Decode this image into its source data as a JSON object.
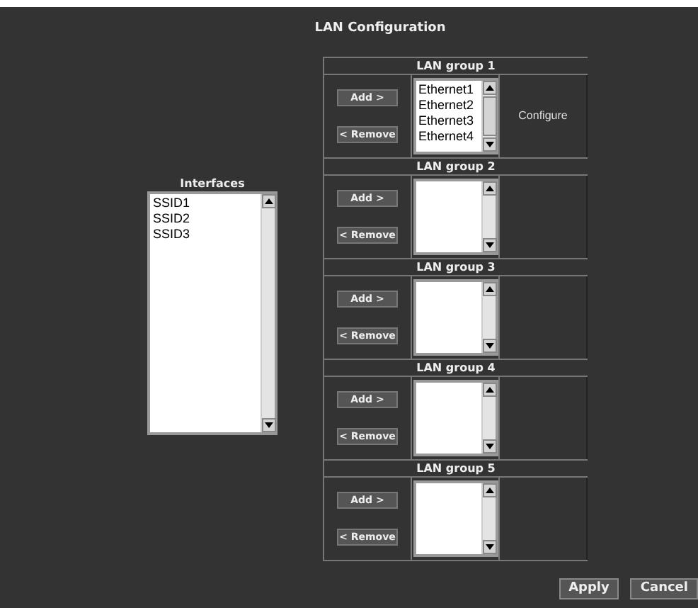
{
  "title": "LAN Configuration",
  "interfaces": {
    "label": "Interfaces",
    "items": [
      "SSID1",
      "SSID2",
      "SSID3"
    ]
  },
  "groups": [
    {
      "name": "LAN group 1",
      "add": "Add >",
      "remove": "< Remove",
      "items": [
        "Ethernet1",
        "Ethernet2",
        "Ethernet3",
        "Ethernet4"
      ],
      "link": "Configure"
    },
    {
      "name": "LAN group 2",
      "add": "Add >",
      "remove": "< Remove"
    },
    {
      "name": "LAN group 3",
      "add": "Add >",
      "remove": "< Remove"
    },
    {
      "name": "LAN group 4",
      "add": "Add >",
      "remove": "< Remove"
    },
    {
      "name": "LAN group 5",
      "add": "Add >",
      "remove": "< Remove"
    }
  ],
  "buttons": [
    "Apply",
    "Cancel"
  ]
}
